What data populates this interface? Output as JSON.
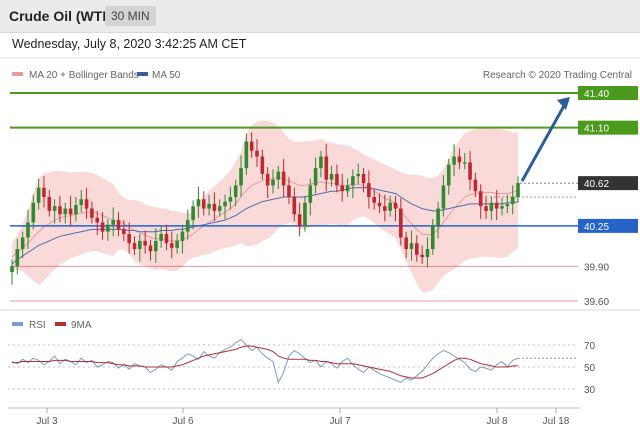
{
  "header": {
    "title": "Crude Oil (WTI)",
    "timeframe": "30 MIN"
  },
  "timestamp": "Wednesday, July 8, 2020 3:42:25 AM CET",
  "credit": "Research © 2020 Trading Central",
  "colors": {
    "target": "#4a9a1c",
    "resistance": "#4a9a1c",
    "support": "#cc4444",
    "pivot": "#2563c9",
    "last": "#333333",
    "bands": "#f8c9c9",
    "ma20": "#e89a9a",
    "ma50": "#4a6fb0",
    "up": "#2e8b2e",
    "down": "#c0282d",
    "rsi": "#7a9cc9",
    "rsi_ma": "#b03030",
    "arrow": "#2a5e9a"
  },
  "chart_data": [
    {
      "type": "candlestick",
      "legend": [
        "MA 20 + Bollinger Bands",
        "MA 50"
      ],
      "x_ticks": [
        "Jul 3",
        "Jul 6",
        "Jul 7",
        "Jul 8",
        "Jul 18"
      ],
      "ylim": [
        39.5,
        41.5
      ],
      "levels": [
        {
          "role": "target",
          "value": 41.4,
          "label": "41.40"
        },
        {
          "role": "resistance",
          "value": 41.1,
          "label": "41.10"
        },
        {
          "role": "last",
          "value": 40.62,
          "label": "40.62"
        },
        {
          "role": "pivot",
          "value": 40.25,
          "label": "40.25"
        },
        {
          "role": "support",
          "value": 39.9,
          "label": "39.90"
        },
        {
          "role": "support",
          "value": 39.6,
          "label": "39.60"
        }
      ],
      "close": [
        39.9,
        40.05,
        40.15,
        40.28,
        40.45,
        40.58,
        40.5,
        40.38,
        40.42,
        40.35,
        40.4,
        40.35,
        40.43,
        40.48,
        40.4,
        40.32,
        40.28,
        40.2,
        40.26,
        40.3,
        40.22,
        40.18,
        40.1,
        40.05,
        40.12,
        40.08,
        40.03,
        40.12,
        40.18,
        40.1,
        40.06,
        40.12,
        40.2,
        40.3,
        40.42,
        40.48,
        40.4,
        40.44,
        40.38,
        40.42,
        40.46,
        40.5,
        40.6,
        40.75,
        40.98,
        40.9,
        40.85,
        40.7,
        40.6,
        40.65,
        40.72,
        40.6,
        40.5,
        40.35,
        40.25,
        40.45,
        40.6,
        40.75,
        40.85,
        40.65,
        40.7,
        40.6,
        40.55,
        40.6,
        40.68,
        40.7,
        40.62,
        40.5,
        40.45,
        40.42,
        40.38,
        40.45,
        40.4,
        40.15,
        40.05,
        40.1,
        40.0,
        39.98,
        40.05,
        40.25,
        40.4,
        40.6,
        40.78,
        40.85,
        40.8,
        40.8,
        40.65,
        40.55,
        40.42,
        40.38,
        40.45,
        40.4,
        40.42,
        40.44,
        40.5,
        40.62
      ],
      "ma20": [
        39.98,
        40.02,
        40.06,
        40.1,
        40.15,
        40.2,
        40.24,
        40.27,
        40.3,
        40.32,
        40.33,
        40.34,
        40.35,
        40.36,
        40.37,
        40.37,
        40.36,
        40.34,
        40.32,
        40.3,
        40.29,
        40.27,
        40.24,
        40.21,
        40.19,
        40.17,
        40.15,
        40.14,
        40.14,
        40.13,
        40.12,
        40.12,
        40.13,
        40.15,
        40.18,
        40.22,
        40.25,
        40.28,
        40.31,
        40.34,
        40.37,
        40.4,
        40.44,
        40.5,
        40.56,
        40.6,
        40.62,
        40.64,
        40.65,
        40.66,
        40.67,
        40.66,
        40.64,
        40.62,
        40.6,
        40.6,
        40.61,
        40.62,
        40.63,
        40.62,
        40.62,
        40.61,
        40.6,
        40.6,
        40.61,
        40.61,
        40.6,
        40.58,
        40.55,
        40.52,
        40.49,
        40.47,
        40.44,
        40.38,
        40.32,
        40.27,
        40.22,
        40.18,
        40.17,
        40.18,
        40.22,
        40.28,
        40.34,
        40.4,
        40.45,
        40.5,
        40.52,
        40.53,
        40.54,
        40.54,
        40.54,
        40.53,
        40.53,
        40.53,
        40.54,
        40.56
      ],
      "ma50": [
        39.92,
        39.96,
        39.99,
        40.02,
        40.05,
        40.08,
        40.1,
        40.12,
        40.14,
        40.16,
        40.17,
        40.18,
        40.19,
        40.2,
        40.21,
        40.22,
        40.22,
        40.22,
        40.22,
        40.22,
        40.22,
        40.22,
        40.21,
        40.21,
        40.2,
        40.2,
        40.2,
        40.2,
        40.21,
        40.21,
        40.21,
        40.22,
        40.22,
        40.23,
        40.24,
        40.25,
        40.26,
        40.27,
        40.28,
        40.29,
        40.3,
        40.32,
        40.34,
        40.37,
        40.4,
        40.42,
        40.44,
        40.46,
        40.47,
        40.48,
        40.49,
        40.5,
        40.5,
        40.5,
        40.5,
        40.5,
        40.51,
        40.52,
        40.53,
        40.54,
        40.55,
        40.55,
        40.56,
        40.57,
        40.58,
        40.58,
        40.58,
        40.58,
        40.57,
        40.56,
        40.55,
        40.54,
        40.53,
        40.5,
        40.47,
        40.44,
        40.42,
        40.4,
        40.39,
        40.38,
        40.38,
        40.39,
        40.4,
        40.41,
        40.42,
        40.43,
        40.44,
        40.44,
        40.44,
        40.44,
        40.44,
        40.44,
        40.44,
        40.45,
        40.45,
        40.46
      ]
    },
    {
      "type": "line",
      "legend": [
        "RSI",
        "9MA"
      ],
      "y_ticks": [
        70,
        50,
        30
      ],
      "ylim": [
        20,
        80
      ],
      "rsi": [
        55,
        53,
        57,
        54,
        58,
        56,
        52,
        55,
        60,
        53,
        57,
        55,
        52,
        58,
        54,
        56,
        50,
        52,
        55,
        54,
        49,
        52,
        48,
        53,
        51,
        50,
        45,
        48,
        52,
        50,
        47,
        55,
        58,
        62,
        60,
        57,
        64,
        60,
        58,
        63,
        66,
        68,
        72,
        75,
        70,
        65,
        68,
        62,
        58,
        55,
        36,
        45,
        60,
        65,
        62,
        58,
        54,
        56,
        50,
        55,
        53,
        49,
        55,
        58,
        52,
        48,
        45,
        50,
        47,
        44,
        42,
        40,
        38,
        36,
        40,
        38,
        42,
        46,
        52,
        58,
        62,
        65,
        63,
        60,
        57,
        54,
        48,
        46,
        50,
        49,
        47,
        52,
        55,
        50,
        56,
        58
      ],
      "ma9": [
        54,
        54,
        55,
        55,
        55,
        55,
        55,
        55,
        56,
        56,
        56,
        55,
        55,
        55,
        55,
        55,
        54,
        54,
        54,
        53,
        52,
        52,
        51,
        51,
        51,
        50,
        50,
        50,
        50,
        50,
        50,
        51,
        52,
        54,
        56,
        58,
        60,
        61,
        62,
        63,
        64,
        65,
        66,
        68,
        69,
        69,
        68,
        67,
        66,
        64,
        60,
        58,
        57,
        57,
        57,
        57,
        56,
        56,
        55,
        55,
        54,
        53,
        53,
        53,
        53,
        52,
        51,
        50,
        49,
        48,
        47,
        46,
        44,
        42,
        41,
        40,
        40,
        40,
        42,
        44,
        47,
        50,
        53,
        56,
        58,
        58,
        57,
        55,
        53,
        52,
        51,
        50,
        50,
        50,
        51,
        51
      ]
    }
  ]
}
